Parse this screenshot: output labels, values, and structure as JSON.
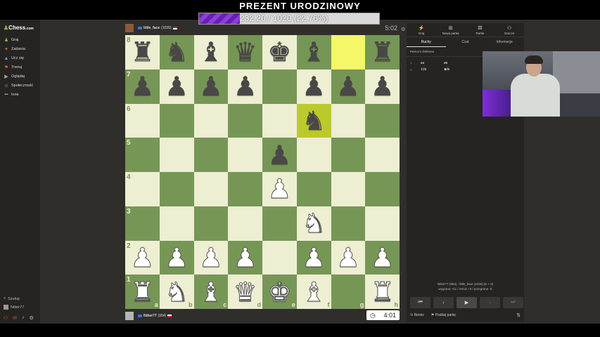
{
  "banner": {
    "title": "PREZENT URODZINOWY",
    "goal_text": "232.20 / 1020 (22.76%)",
    "goal_progress": 0.2276
  },
  "sidebar": {
    "logo_text": "Chess",
    "logo_suffix": ".com",
    "items": [
      {
        "label": "Graj",
        "icon": "♟"
      },
      {
        "label": "Zadania",
        "icon": "✦"
      },
      {
        "label": "Ucz się",
        "icon": "🎓"
      },
      {
        "label": "Trenuj",
        "icon": "⚑"
      },
      {
        "label": "Oglądaj",
        "icon": "▶"
      },
      {
        "label": "Społeczność",
        "icon": "☺"
      },
      {
        "label": "Inne",
        "icon": "•••"
      }
    ],
    "search_label": "Szukaj",
    "user_label": "Nitter77"
  },
  "players": {
    "top": {
      "name": "little_face",
      "rating": "(1036)",
      "clock": "5:02"
    },
    "bottom": {
      "name": "Nitter77",
      "rating": "(954)",
      "clock": "4:01"
    }
  },
  "board": {
    "ranks": [
      "8",
      "7",
      "6",
      "5",
      "4",
      "3",
      "2",
      "1"
    ],
    "files": [
      "a",
      "b",
      "c",
      "d",
      "e",
      "f",
      "g",
      "h"
    ],
    "rows": [
      [
        "br",
        "bn",
        "bb",
        "bq",
        "bk",
        "bb",
        "",
        "br"
      ],
      [
        "bp",
        "bp",
        "bp",
        "bp",
        "",
        "bp",
        "bp",
        "bp"
      ],
      [
        "",
        "",
        "",
        "",
        "",
        "bn",
        "",
        ""
      ],
      [
        "",
        "",
        "",
        "",
        "bp",
        "",
        "",
        ""
      ],
      [
        "",
        "",
        "",
        "",
        "wp",
        "",
        "",
        ""
      ],
      [
        "",
        "",
        "",
        "",
        "",
        "wn",
        "",
        ""
      ],
      [
        "wp",
        "wp",
        "wp",
        "wp",
        "",
        "wp",
        "wp",
        "wp"
      ],
      [
        "wr",
        "wn",
        "wb",
        "wq",
        "wk",
        "wb",
        "",
        "wr"
      ]
    ],
    "highlights": [
      [
        0,
        6
      ],
      [
        2,
        5
      ]
    ],
    "colors": {
      "light": "#eeeed2",
      "dark": "#769656"
    }
  },
  "panel": {
    "tabs": [
      {
        "label": "Graj",
        "icon": "⚡"
      },
      {
        "label": "Nowa partia",
        "icon": "⊞"
      },
      {
        "label": "Partie",
        "icon": "⚄"
      },
      {
        "label": "Gracze",
        "icon": "⚇"
      }
    ],
    "subtabs": [
      "Ruchy",
      "Czat",
      "Informacje"
    ],
    "opening": "Petrov's Defense",
    "moves": [
      {
        "num": "1.",
        "white": "e4",
        "black": "e5"
      },
      {
        "num": "2.",
        "white": "♘f3",
        "black": "♞f6"
      }
    ],
    "summary_line1": "Nitter77 (954) - little_face (1036) (5 + 3)",
    "summary_line2": "wygrana +11 / remis +3 / przegrane -5",
    "actions": {
      "draw": "Remis",
      "resign": "Poddaj partię"
    }
  }
}
